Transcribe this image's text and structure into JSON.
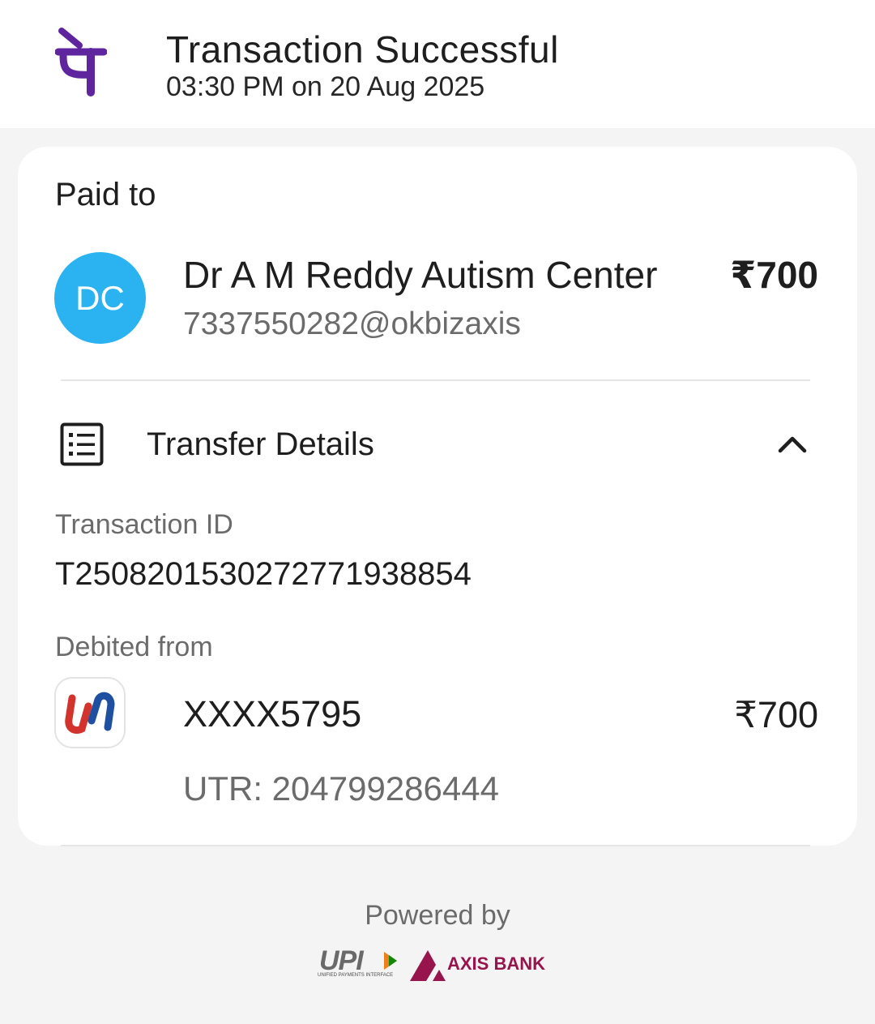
{
  "header": {
    "title": "Transaction Successful",
    "subtitle": "03:30 PM on 20 Aug 2025",
    "brand_icon": "phonepe-logo-icon",
    "brand_color": "#5f259f"
  },
  "paid_to": {
    "label": "Paid to",
    "avatar_initials": "DC",
    "avatar_color": "#2bb3f1",
    "name": "Dr A M Reddy Autism Center",
    "upi_id": "7337550282@okbizaxis",
    "amount": "₹700"
  },
  "transfer_details": {
    "title": "Transfer Details",
    "icon": "document-list-icon",
    "toggle_icon": "chevron-up-icon",
    "transaction_id_label": "Transaction ID",
    "transaction_id": "T2508201530272771938854",
    "debited_from_label": "Debited from",
    "bank_icon": "union-bank-logo-icon",
    "account": "XXXX5795",
    "debited_amount": "₹700",
    "utr": "UTR: 204799286444"
  },
  "footer": {
    "powered_by": "Powered by",
    "upi_label": "UPI",
    "upi_sub": "UNIFIED PAYMENTS INTERFACE",
    "bank_label": "AXIS BANK",
    "bank_color": "#97144d"
  }
}
